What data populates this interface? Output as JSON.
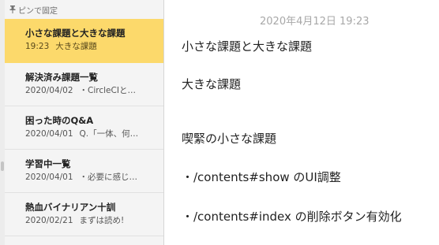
{
  "sidebar": {
    "pinned_header": "ピンで固定",
    "pin_icon": "pin-icon",
    "notes": [
      {
        "title": "小さな課題と大きな課題",
        "date": "19:23",
        "preview": "大きな課題",
        "selected": true
      },
      {
        "title": "解決済み課題一覧",
        "date": "2020/04/02",
        "preview": "・CircleCIと…",
        "selected": false
      },
      {
        "title": "困った時のQ&A",
        "date": "2020/04/01",
        "preview": "Q.「一体、何…",
        "selected": false
      },
      {
        "title": "学習中一覧",
        "date": "2020/04/01",
        "preview": "・必要に感じ…",
        "selected": false
      },
      {
        "title": "熱血バイナリアン十訓",
        "date": "2020/02/21",
        "preview": "まずは読め!",
        "selected": false
      }
    ]
  },
  "editor": {
    "timestamp": "2020年4月12日 19:23",
    "lines": [
      "小さな課題と大きな課題",
      "大きな課題",
      "喫緊の小さな課題",
      "・/contents#show のUI調整",
      "・/contents#index の削除ボタン有効化"
    ]
  },
  "colors": {
    "selected_note": "#fcd96b",
    "sidebar_background": "#f4f4f4",
    "timestamp_text": "#a8a8a8"
  }
}
